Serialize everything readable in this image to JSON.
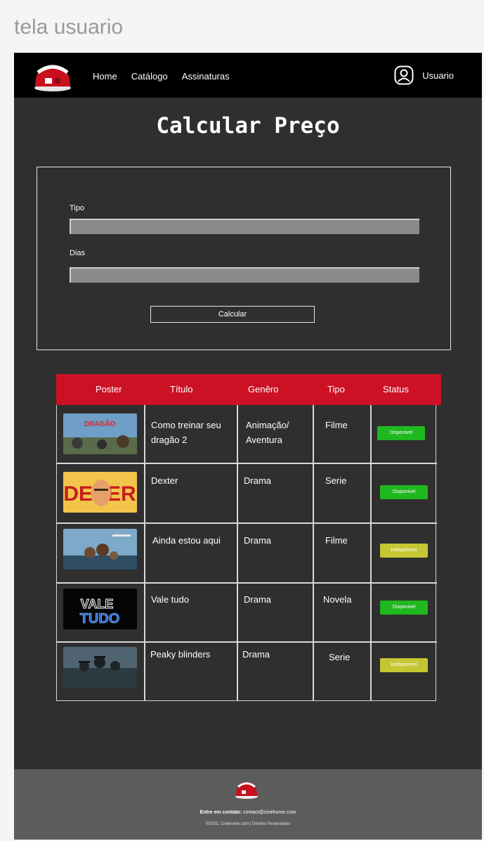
{
  "frame_label": "tela usuario",
  "nav": {
    "links": [
      "Home",
      "Catálogo",
      "Assinaturas"
    ],
    "user_label": "Usuario"
  },
  "page_title": "Calcular Preço",
  "form": {
    "tipo_label": "Tipo",
    "tipo_value": "",
    "dias_label": "Dias",
    "dias_value": "",
    "button_label": "Calcular"
  },
  "table": {
    "headers": [
      "Poster",
      "Título",
      "Genêro",
      "Tipo",
      "Status"
    ],
    "rows": [
      {
        "title": "Como treinar seu dragão 2",
        "genre": "Animação/ Aventura",
        "type": "Filme",
        "status": "Disponivel",
        "status_kind": "ok",
        "poster_icon": "dragon-poster"
      },
      {
        "title": "Dexter",
        "genre": "Drama",
        "type": "Serie",
        "status": "Disponivel",
        "status_kind": "ok",
        "poster_icon": "dexter-poster"
      },
      {
        "title": "Ainda estou aqui",
        "genre": "Drama",
        "type": "Filme",
        "status": "Indisponivel",
        "status_kind": "no",
        "poster_icon": "ainda-estou-aqui-poster"
      },
      {
        "title": "Vale tudo",
        "genre": "Drama",
        "type": "Novela",
        "status": "Disponivel",
        "status_kind": "ok",
        "poster_icon": "vale-tudo-poster"
      },
      {
        "title": "Peaky blinders",
        "genre": "Drama",
        "type": "Serie",
        "status": "Indisponivel",
        "status_kind": "no",
        "poster_icon": "peaky-blinders-poster"
      }
    ]
  },
  "footer": {
    "contact_label": "Entre em contato:",
    "contact_email": "contact@cinehome.com",
    "copyright": "©2025, Cinehome.com | Direitos Reservados"
  },
  "colors": {
    "accent": "#cc1124",
    "available": "#1fb81f",
    "unavailable": "#c6c635",
    "background": "#2f2f2f",
    "nav": "#000000",
    "footer": "#5c5c5c"
  }
}
